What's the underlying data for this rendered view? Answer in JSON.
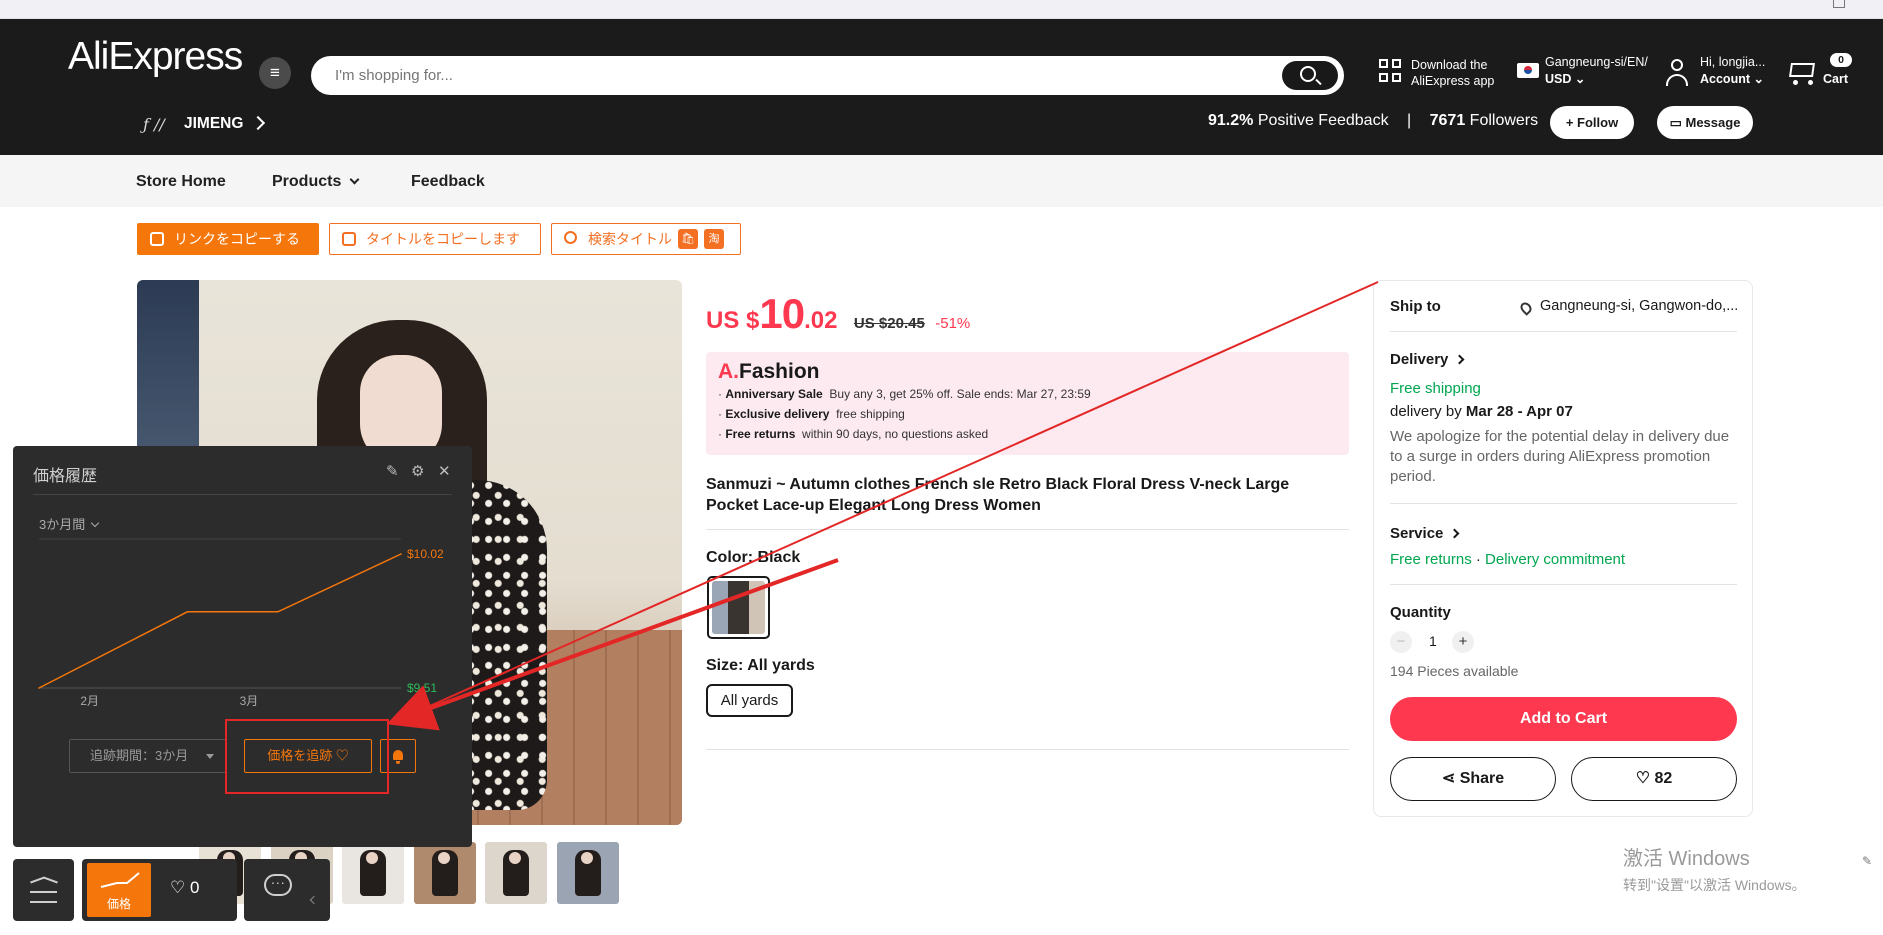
{
  "header": {
    "logo": "AliExpress",
    "search_placeholder": "I'm shopping for...",
    "download_line1": "Download the",
    "download_line2": "AliExpress app",
    "region_line1": "Gangneung-si/EN/",
    "region_line2": "USD",
    "greeting": "Hi, longjia...",
    "account_label": "Account",
    "cart_count": "0",
    "cart_label": "Cart"
  },
  "store": {
    "name": "JIMENG",
    "logo_mark": "ƒ //",
    "positive_feedback": "91.2%",
    "positive_feedback_label": "Positive Feedback",
    "separator": "|",
    "followers": "7671",
    "followers_label": "Followers",
    "follow_label": "+ Follow",
    "message_label": "Message"
  },
  "nav": {
    "items": [
      "Store Home",
      "Products",
      "Feedback"
    ]
  },
  "toolbar": {
    "copy_link": "リンクをコピーする",
    "copy_title": "タイトルをコピーします",
    "search_title": "検索タイトル",
    "badge1": "🛍",
    "badge2": "淘"
  },
  "product": {
    "currency": "US $",
    "price_int": "10",
    "price_dec": ".02",
    "original_price": "US $20.45",
    "discount": "-51%",
    "promo_brand_a": "A.",
    "promo_brand_rest": "Fashion",
    "promo_lines": [
      {
        "bold": "Anniversary Sale",
        "text": "Buy any 3, get 25% off. Sale ends: Mar 27, 23:59"
      },
      {
        "bold": "Exclusive delivery",
        "text": "free shipping"
      },
      {
        "bold": "Free returns",
        "text": "within 90 days, no questions asked"
      }
    ],
    "title": "Sanmuzi ~ Autumn clothes French sle Retro Black Floral Dress V-neck Large Pocket Lace-up Elegant Long Dress Women",
    "color_label": "Color: Black",
    "size_label": "Size: All yards",
    "size_option": "All yards"
  },
  "right_panel": {
    "ship_to_label": "Ship to",
    "ship_to_value": "Gangneung-si, Gangwon-do,...",
    "delivery_label": "Delivery",
    "free_shipping": "Free shipping",
    "delivery_by_prefix": "delivery by",
    "delivery_dates": "Mar 28 - Apr 07",
    "delay_note": "We apologize for the potential delay in delivery due to a surge in orders during AliExpress promotion period.",
    "service_label": "Service",
    "free_returns": "Free returns",
    "dot": "·",
    "delivery_commitment": "Delivery commitment",
    "quantity_label": "Quantity",
    "quantity_value": "1",
    "minus": "−",
    "plus": "+",
    "available": "194 Pieces available",
    "add_to_cart": "Add to Cart",
    "share": "Share",
    "wishlist_count": "82"
  },
  "price_history": {
    "title": "価格履歴",
    "period": "3か月間",
    "track_period": "追跡期間：3か月",
    "track_price": "価格を追跡 ♡",
    "dock_price_label": "価格",
    "dock_heart_count": "0",
    "icons": [
      "edit-icon",
      "gear-icon",
      "close-icon"
    ],
    "chart_data": {
      "type": "line",
      "x": [
        "2月",
        "3月"
      ],
      "series": [
        {
          "values": [
            9.51,
            9.8,
            9.8,
            10.02
          ]
        }
      ],
      "labels": {
        "max": "$10.02",
        "min": "$9.51"
      },
      "ylim": [
        9.51,
        10.02
      ],
      "line_color": "#f5760b"
    }
  },
  "watermark": {
    "line1": "激活 Windows",
    "line2": "转到\"设置\"以激活 Windows。"
  },
  "colors": {
    "accent_red": "#fd384f",
    "accent_orange": "#f5760b",
    "header_bg": "#1b1b1b",
    "green": "#00a650"
  }
}
